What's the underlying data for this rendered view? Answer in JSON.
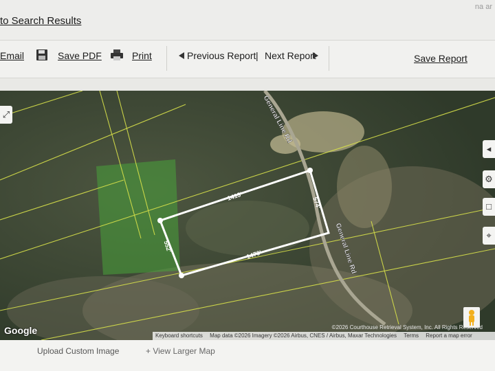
{
  "topbar": {
    "back_link": "to Search Results",
    "corner_text": "na ar"
  },
  "toolbar": {
    "email": "Email",
    "save_pdf": "Save PDF",
    "print": "Print",
    "previous_report": "Previous Report",
    "separator": "|",
    "next_report": "Next Report",
    "save_report": "Save Report"
  },
  "map": {
    "road_label_top": "General Line Rd",
    "road_label_bottom": "General Line Rd",
    "dimensions": {
      "top": "1413'",
      "right": "574'",
      "bottom": "1470'",
      "left": "552'"
    },
    "google_logo": "Google",
    "image_credit": "©2026 Courthouse Retrieval System, Inc. All Rights Reserved",
    "attribution": {
      "keyboard": "Keyboard shortcuts",
      "map_data": "Map data ©2026 Imagery ©2026 Airbus, CNES / Airbus, Maxar Technologies",
      "terms": "Terms",
      "report": "Report a map error"
    },
    "icons": {
      "fullscreen": "fullscreen-icon",
      "settings": "gear-icon",
      "draw": "polygon-icon",
      "locate": "locate-icon",
      "street_view": "pegman-icon"
    }
  },
  "footer": {
    "upload": "Upload Custom Image",
    "larger_map": "+ View Larger Map"
  }
}
